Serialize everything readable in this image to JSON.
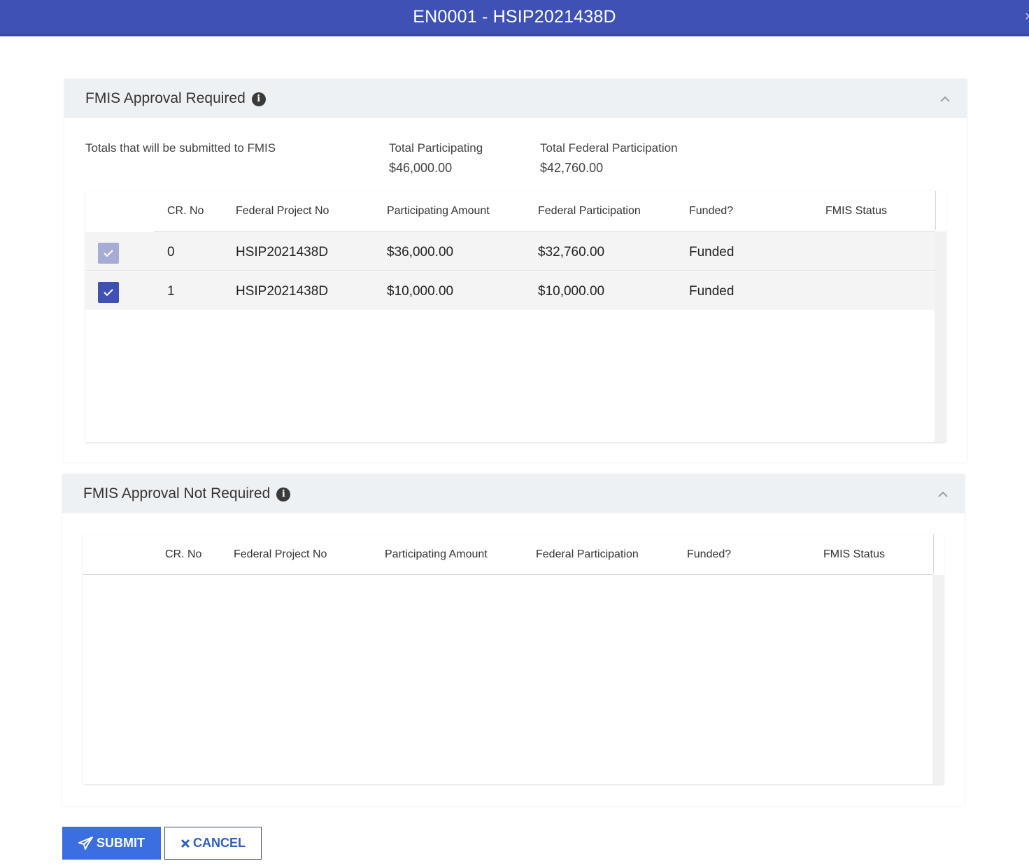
{
  "window": {
    "title": "EN0001 - HSIP2021438D",
    "close_glyph": "×"
  },
  "section_required": {
    "title": "FMIS Approval Required",
    "info_glyph": "i",
    "totals_label": "Totals that will be submitted to FMIS",
    "total_participating_label": "Total Participating",
    "total_participating_value": "$46,000.00",
    "total_federal_label": "Total Federal Participation",
    "total_federal_value": "$42,760.00",
    "columns": [
      "CR. No",
      "Federal Project No",
      "Participating Amount",
      "Federal Participation",
      "Funded?",
      "FMIS Status"
    ],
    "rows": [
      {
        "checked": true,
        "disabled": true,
        "cr_no": "0",
        "project": "HSIP2021438D",
        "participating": "$36,000.00",
        "federal": "$32,760.00",
        "funded": "Funded",
        "status": ""
      },
      {
        "checked": true,
        "disabled": false,
        "cr_no": "1",
        "project": "HSIP2021438D",
        "participating": "$10,000.00",
        "federal": "$10,000.00",
        "funded": "Funded",
        "status": ""
      }
    ]
  },
  "section_not_required": {
    "title": "FMIS Approval Not Required",
    "info_glyph": "i",
    "columns": [
      "CR. No",
      "Federal Project No",
      "Participating Amount",
      "Federal Participation",
      "Funded?",
      "FMIS Status"
    ],
    "rows": []
  },
  "actions": {
    "submit_label": "SUBMIT",
    "cancel_label": "CANCEL"
  },
  "colors": {
    "title_bar": "#3f51b5",
    "checkbox_checked": "#3f51b5",
    "checkbox_disabled": "#a6acd6",
    "submit_button": "#3b6ee0"
  }
}
